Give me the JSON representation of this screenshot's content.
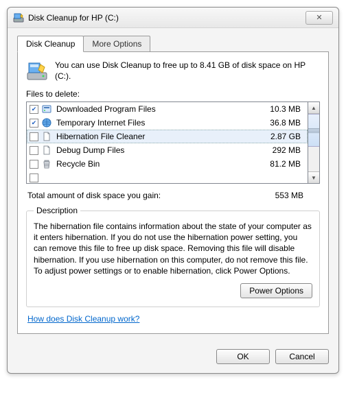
{
  "window": {
    "title": "Disk Cleanup for HP (C:)"
  },
  "tabs": {
    "cleanup": "Disk Cleanup",
    "more": "More Options"
  },
  "intro": "You can use Disk Cleanup to free up to 8.41 GB of disk space on HP (C:).",
  "files_label": "Files to delete:",
  "files": [
    {
      "checked": true,
      "name": "Downloaded Program Files",
      "size": "10.3 MB",
      "icon": "program-icon"
    },
    {
      "checked": true,
      "name": "Temporary Internet Files",
      "size": "36.8 MB",
      "icon": "internet-icon"
    },
    {
      "checked": false,
      "name": "Hibernation File Cleaner",
      "size": "2.87 GB",
      "icon": "file-icon",
      "selected": true
    },
    {
      "checked": false,
      "name": "Debug Dump Files",
      "size": "292 MB",
      "icon": "file-icon"
    },
    {
      "checked": false,
      "name": "Recycle Bin",
      "size": "81.2 MB",
      "icon": "recycle-icon"
    }
  ],
  "total": {
    "label": "Total amount of disk space you gain:",
    "value": "553 MB"
  },
  "description": {
    "legend": "Description",
    "text": "The hibernation file contains information about the state of your computer as it enters hibernation. If you do not use the hibernation power setting, you can remove this file to free up disk space. Removing this file will disable hibernation. If you use hibernation on this computer, do not remove this file. To adjust power settings or to enable hibernation, click Power Options."
  },
  "buttons": {
    "power_options": "Power Options",
    "ok": "OK",
    "cancel": "Cancel"
  },
  "link": "How does Disk Cleanup work?"
}
